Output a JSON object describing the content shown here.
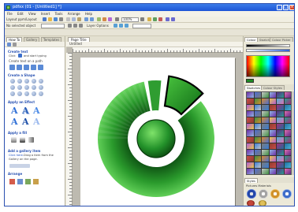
{
  "window": {
    "title": "pdfxx (01 - [Untitled1] *]",
    "menu": [
      "File",
      "Edit",
      "View",
      "Insert",
      "Tools",
      "Arrange",
      "Help"
    ]
  },
  "toolbar": {
    "zoom_value": "100%",
    "layout_label": "Layout ppm/Layout",
    "options_label": "Layer Options",
    "no_selection": "No selected object"
  },
  "left_panel": {
    "tabs": [
      "How To",
      "Gallery",
      "Templates"
    ],
    "sections": [
      {
        "title": "Create text",
        "lines": [
          "Click",
          "and start typing"
        ],
        "link": ""
      },
      {
        "title": "Create text on a path",
        "lines": [],
        "link": ""
      },
      {
        "title": "Create a Shape",
        "lines": [],
        "link": ""
      },
      {
        "title": "Apply an Effect",
        "lines": [],
        "link": ""
      },
      {
        "title": "Apply a fill",
        "lines": [],
        "link": ""
      },
      {
        "title": "Add a gallery item",
        "lines": [
          "Drag a item from the",
          "Gallery on the page."
        ],
        "link": "Click here."
      },
      {
        "title": "Arrange",
        "lines": [],
        "link": ""
      }
    ]
  },
  "canvas": {
    "tab_label": "Page Title",
    "sub_label": "Untitled"
  },
  "right_panel": {
    "colors_tabs": [
      "Colour",
      "Swatch",
      "Colour Picker"
    ],
    "swatch_tabs": [
      "Swatches",
      "Colour Styles"
    ],
    "style_tabs": [
      "Styles"
    ],
    "style_caption": "Pictures  Materials"
  },
  "colors": {
    "accent": "#1f8a26",
    "dark_green": "#0f5a14",
    "light_green": "#6fdc68",
    "titlebar": "#2a62d9"
  }
}
